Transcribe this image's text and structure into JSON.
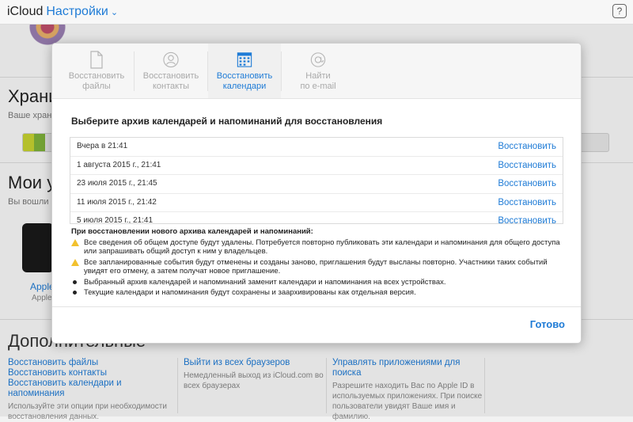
{
  "topbar": {
    "app": "iCloud",
    "section": "Настройки",
    "help": "?"
  },
  "background": {
    "storage_heading": "Храни",
    "storage_sub": "Ваше храни",
    "devices_heading": "Мои у",
    "devices_sub": "Вы вошли в",
    "device_name": "Apple",
    "device_sub": "Apple",
    "more_heading": "Дополнительные",
    "col1": {
      "links": [
        "Восстановить файлы",
        "Восстановить контакты",
        "Восстановить календари и напоминания"
      ],
      "desc": "Используйте эти опции при необходимости восстановления данных."
    },
    "col2": {
      "links": [
        "Выйти из всех браузеров"
      ],
      "desc": "Немедленный выход из iCloud.com во всех браузерах"
    },
    "col3": {
      "links": [
        "Управлять приложениями для поиска"
      ],
      "desc": "Разрешите находить Вас по Apple ID в используемых приложениях. При поиске пользователи увидят Ваше имя и фамилию."
    }
  },
  "modal": {
    "tabs": [
      {
        "label1": "Восстановить",
        "label2": "файлы",
        "icon": "file-icon"
      },
      {
        "label1": "Восстановить",
        "label2": "контакты",
        "icon": "contact-icon"
      },
      {
        "label1": "Восстановить",
        "label2": "календари",
        "icon": "calendar-icon"
      },
      {
        "label1": "Найти",
        "label2": "по e-mail",
        "icon": "at-icon"
      }
    ],
    "active_tab": 2,
    "title": "Выберите архив календарей и напоминаний для восстановления",
    "archives": [
      {
        "date": "Вчера в 21:41",
        "action": "Восстановить"
      },
      {
        "date": "1 августа 2015 г., 21:41",
        "action": "Восстановить"
      },
      {
        "date": "23 июля 2015 г., 21:45",
        "action": "Восстановить"
      },
      {
        "date": "11 июля 2015 г., 21:42",
        "action": "Восстановить"
      },
      {
        "date": "5 июля 2015 г., 21:41",
        "action": "Восстановить"
      }
    ],
    "notes_heading": "При восстановлении нового архива календарей и напоминаний:",
    "notes": [
      {
        "type": "warning",
        "text": "Все сведения об общем доступе будут удалены. Потребуется повторно публиковать эти календари и напоминания для общего доступа или запрашивать общий доступ к ним у владельцев."
      },
      {
        "type": "warning",
        "text": "Все запланированные события будут отменены и созданы заново, приглашения будут высланы повторно. Участники таких событий увидят его отмену, а затем получат новое приглашение."
      },
      {
        "type": "bullet",
        "text": "Выбранный архив календарей и напоминаний заменит календари и напоминания на всех устройствах."
      },
      {
        "type": "bullet",
        "text": "Текущие календари и напоминания будут сохранены и заархивированы как отдельная версия."
      }
    ],
    "done": "Готово"
  },
  "colors": {
    "accent": "#1e7bd6",
    "warning": "#f2c12e"
  }
}
